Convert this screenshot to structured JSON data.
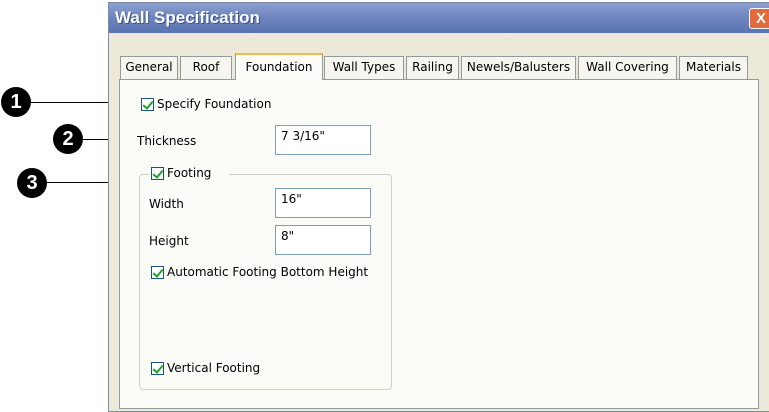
{
  "window": {
    "title": "Wall Specification",
    "close_glyph": "X"
  },
  "tabs": [
    {
      "label": "General"
    },
    {
      "label": "Roof"
    },
    {
      "label": "Foundation"
    },
    {
      "label": "Wall Types"
    },
    {
      "label": "Railing"
    },
    {
      "label": "Newels/Balusters"
    },
    {
      "label": "Wall Covering"
    },
    {
      "label": "Materials"
    }
  ],
  "active_tab": "Foundation",
  "foundation": {
    "specify_foundation": {
      "label": "Specify Foundation",
      "checked": true
    },
    "thickness": {
      "label": "Thickness",
      "value": "7 3/16\""
    },
    "footing": {
      "label": "Footing",
      "checked": true,
      "width": {
        "label": "Width",
        "value": "16\""
      },
      "height": {
        "label": "Height",
        "value": "8\""
      },
      "automatic_bottom": {
        "label": "Automatic Footing Bottom Height",
        "checked": true
      },
      "vertical_footing": {
        "label": "Vertical Footing",
        "checked": true
      }
    }
  },
  "callouts": [
    "1",
    "2",
    "3"
  ],
  "colors": {
    "titlebar": "#6f86c0",
    "close": "#e36a3a",
    "active_tab_accent": "#f7b74b",
    "check": "#21a121"
  }
}
